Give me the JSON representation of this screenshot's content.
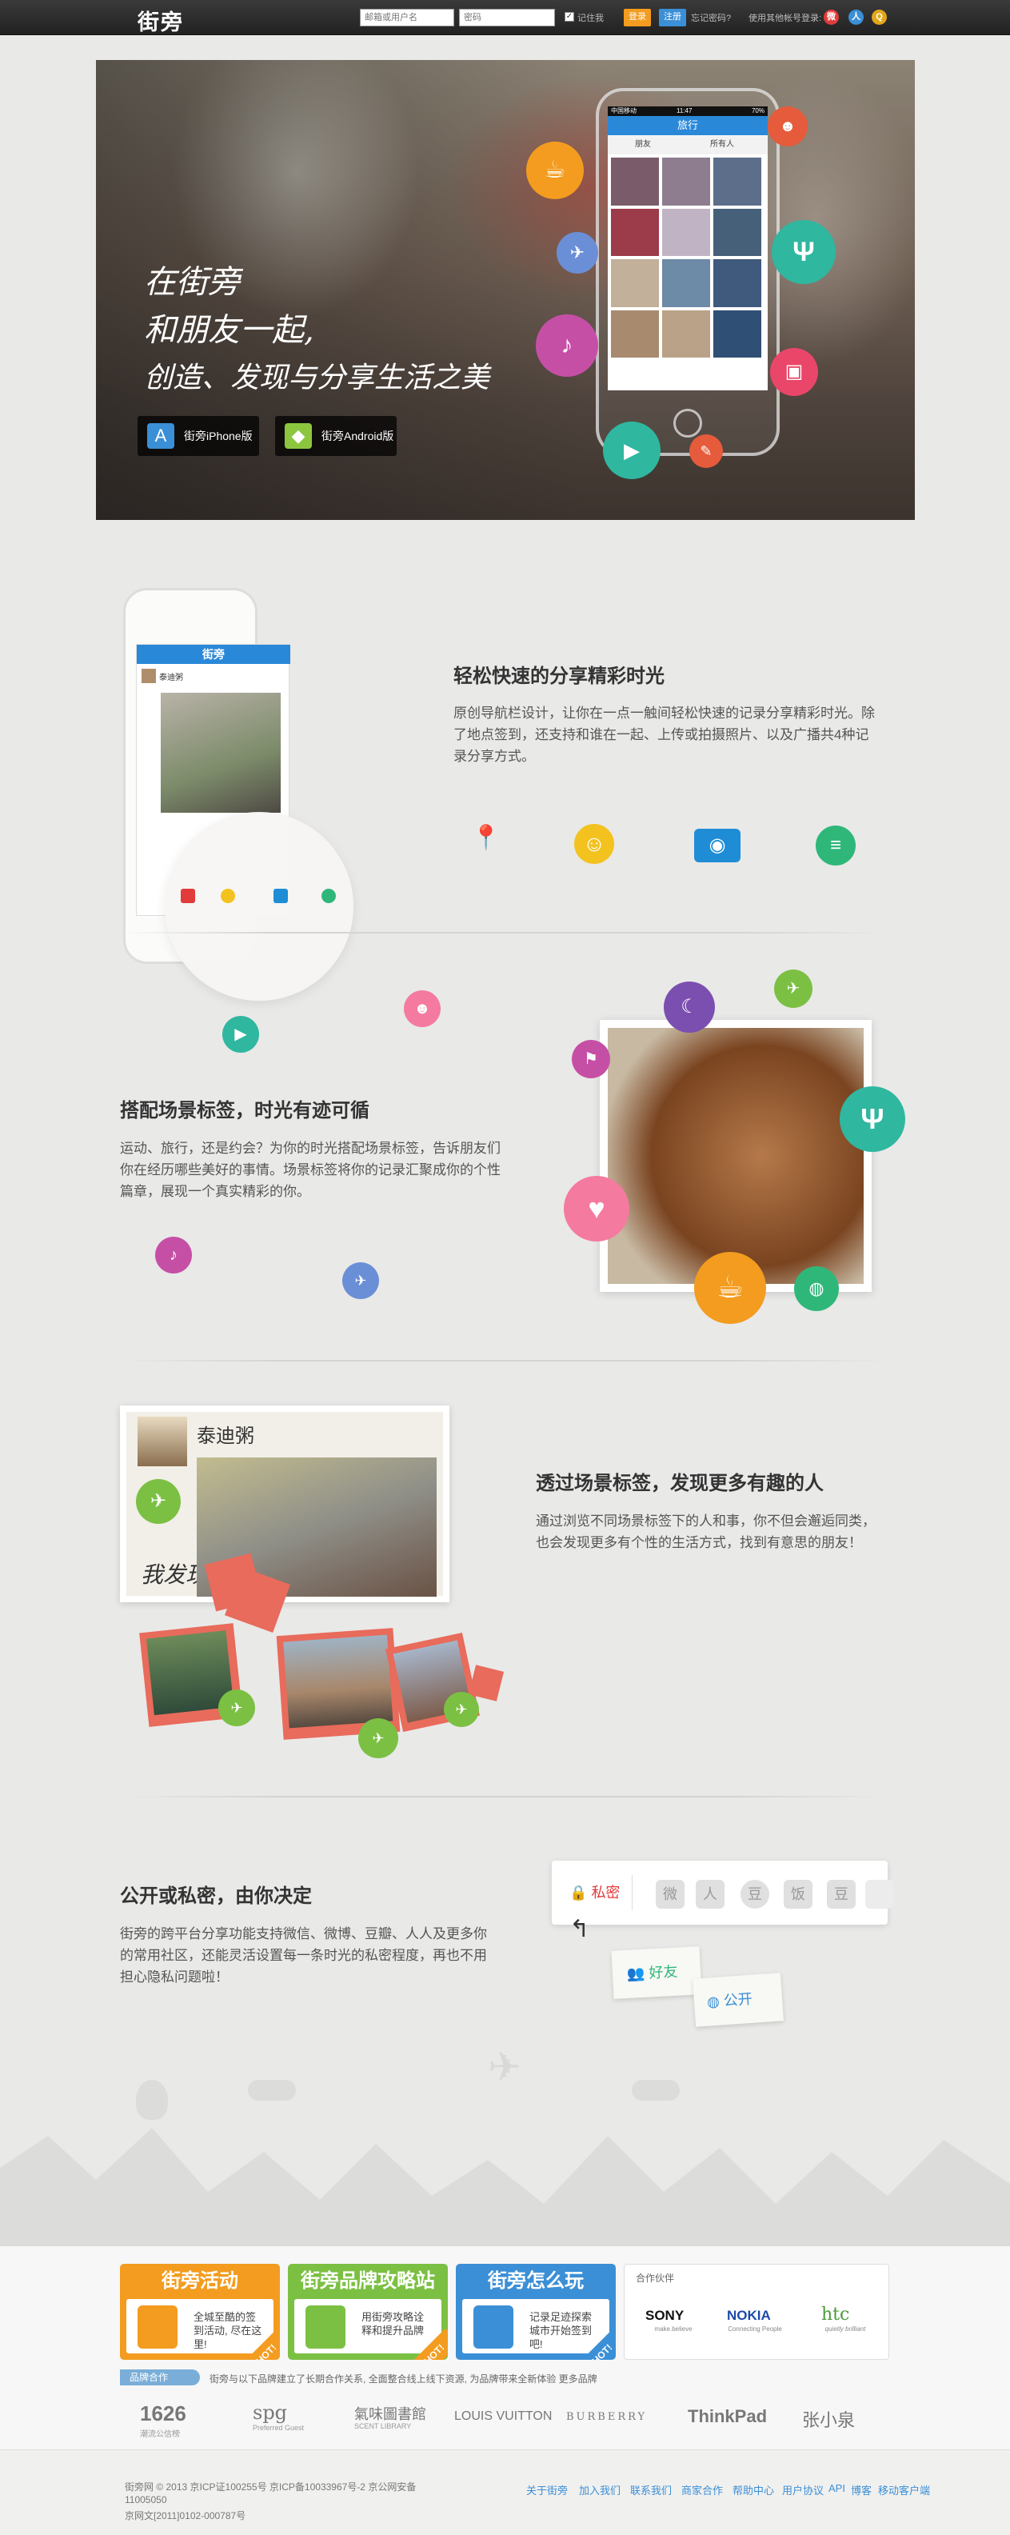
{
  "topbar": {
    "logo": "街旁",
    "username_placeholder": "邮箱或用户名",
    "password_placeholder": "密码",
    "remember_label": "记住我",
    "login_button": "登录",
    "register_button": "注册",
    "forgot_password": "忘记密码?",
    "other_login_label": "使用其他帐号登录:"
  },
  "hero": {
    "tagline_line1": "在街旁",
    "tagline_line2": "和朋友一起,",
    "tagline_line3": "创造、发现与分享生活之美",
    "iphone_button": "街旁iPhone版",
    "android_button": "街旁Android版",
    "phone_screen_title": "旅行",
    "phone_tab1": "朋友",
    "phone_tab2": "所有人",
    "phone_carrier": "中国移动",
    "phone_time": "11:47",
    "phone_battery": "70%"
  },
  "feature1": {
    "title": "轻松快速的分享精彩时光",
    "body": "原创导航栏设计，让你在一点一触间轻松快速的记录分享精彩时光。除了地点签到，还支持和谁在一起、上传或拍摄照片、以及广播共4种记录分享方式。",
    "phone_title": "街旁",
    "phone_user": "泰迪粥"
  },
  "feature2": {
    "title": "搭配场景标签，时光有迹可循",
    "body": "运动、旅行，还是约会？为你的时光搭配场景标签，告诉朋友们你在经历哪些美好的事情。场景标签将你的记录汇聚成你的个性篇章，展现一个真实精彩的你。"
  },
  "feature3": {
    "title": "透过场景标签，发现更多有趣的人",
    "body": "通过浏览不同场景标签下的人和事，你不但会邂逅同类，也会发现更多有个性的生活方式，找到有意思的朋友！",
    "card_user": "泰迪粥",
    "card_hand": "我发现"
  },
  "feature4": {
    "title": "公开或私密，由你决定",
    "body": "街旁的跨平台分享功能支持微信、微博、豆瓣、人人及更多你的常用社区，还能灵活设置每一条时光的私密程度，再也不用担心隐私问题啦！",
    "private_label": "私密",
    "friends_label": "好友",
    "public_label": "公开",
    "share_icons": [
      "微",
      "人",
      "豆",
      "饭",
      "豆"
    ]
  },
  "promo_cards": [
    {
      "title": "街旁活动",
      "text": "全城至酷的签到活动, 尽在这里!",
      "hot": "HOT!"
    },
    {
      "title": "街旁品牌攻略站",
      "text": "用街旁攻略诠释和提升品牌",
      "hot": "HOT!"
    },
    {
      "title": "街旁怎么玩",
      "text": "记录足迹探索城市开始签到吧!",
      "hot": "HOT!"
    }
  ],
  "partner_header": "合作伙伴",
  "partner_logos": [
    "SONY",
    "NOKIA",
    "htc"
  ],
  "partner_subtitles": [
    "make.believe",
    "Connecting People",
    "quietly brilliant"
  ],
  "brands_label": "品牌合作",
  "brands_note": "街旁与以下品牌建立了长期合作关系, 全面整合线上线下资源, 为品牌带来全新体验 更多品牌",
  "brands": [
    "1626",
    "spg",
    "氣味圖書館",
    "LOUIS VUITTON",
    "BURBERRY",
    "ThinkPad",
    "张小泉"
  ],
  "brand_subtitles": [
    "潮流公信榜",
    "Preferred Guest",
    "SCENT LIBRARY"
  ],
  "footer": {
    "copyright": "街旁网 © 2013 京ICP证100255号 京ICP备10033967号-2 京公网安备",
    "line2": "11005050",
    "line3": "京网文[2011]0102-000787号",
    "links": [
      "关于街旁",
      "加入我们",
      "联系我们",
      "商家合作",
      "帮助中心",
      "用户协议",
      "API",
      "博客",
      "移动客户端"
    ]
  },
  "colors": {
    "accent_blue": "#3b8fd6",
    "orange": "#f39c1f",
    "green": "#7bc043",
    "topbar": "#2b2b2b"
  }
}
